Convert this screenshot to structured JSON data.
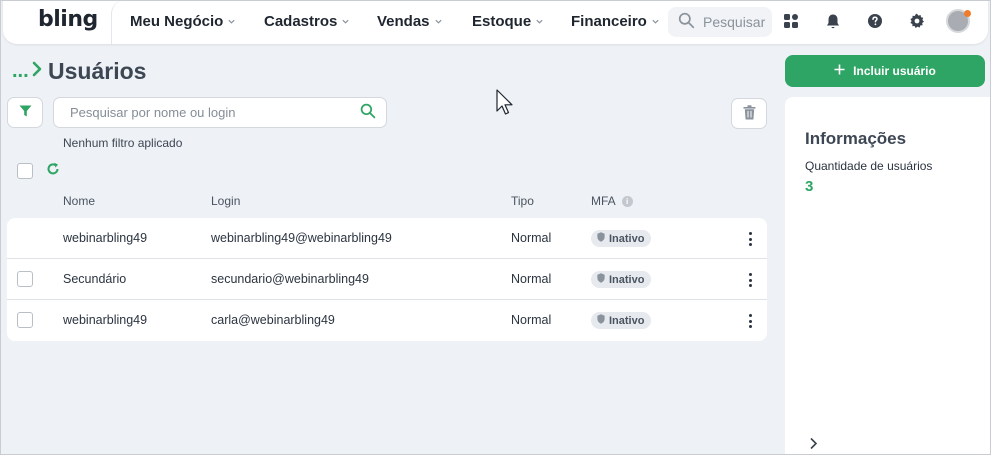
{
  "app": {
    "logo": "bling"
  },
  "nav": {
    "items": [
      {
        "label": "Meu Negócio"
      },
      {
        "label": "Cadastros"
      },
      {
        "label": "Vendas"
      },
      {
        "label": "Estoque"
      },
      {
        "label": "Financeiro"
      }
    ],
    "search_placeholder": "Pesquisar",
    "icons": [
      "apps-icon",
      "bell-icon",
      "help-icon",
      "gear-icon"
    ]
  },
  "page": {
    "breadcrumb": "...",
    "title": "Usuários",
    "include_button": "Incluir usuário",
    "search_placeholder": "Pesquisar por nome ou login",
    "filter_note": "Nenhum filtro aplicado"
  },
  "table": {
    "headers": {
      "name": "Nome",
      "login": "Login",
      "type": "Tipo",
      "mfa": "MFA"
    },
    "rows": [
      {
        "name": "webinarbling49",
        "login": "webinarbling49@webinarbling49",
        "type": "Normal",
        "mfa": "Inativo",
        "checkbox": false
      },
      {
        "name": "Secundário",
        "login": "secundario@webinarbling49",
        "type": "Normal",
        "mfa": "Inativo",
        "checkbox": true
      },
      {
        "name": "webinarbling49",
        "login": "carla@webinarbling49",
        "type": "Normal",
        "mfa": "Inativo",
        "checkbox": true
      }
    ]
  },
  "info": {
    "title": "Informações",
    "users_label": "Quantidade de usuários",
    "users_count": "3"
  },
  "colors": {
    "accent": "#2ea564",
    "title": "#3d4754",
    "badge_bg": "#e6e9ed"
  }
}
